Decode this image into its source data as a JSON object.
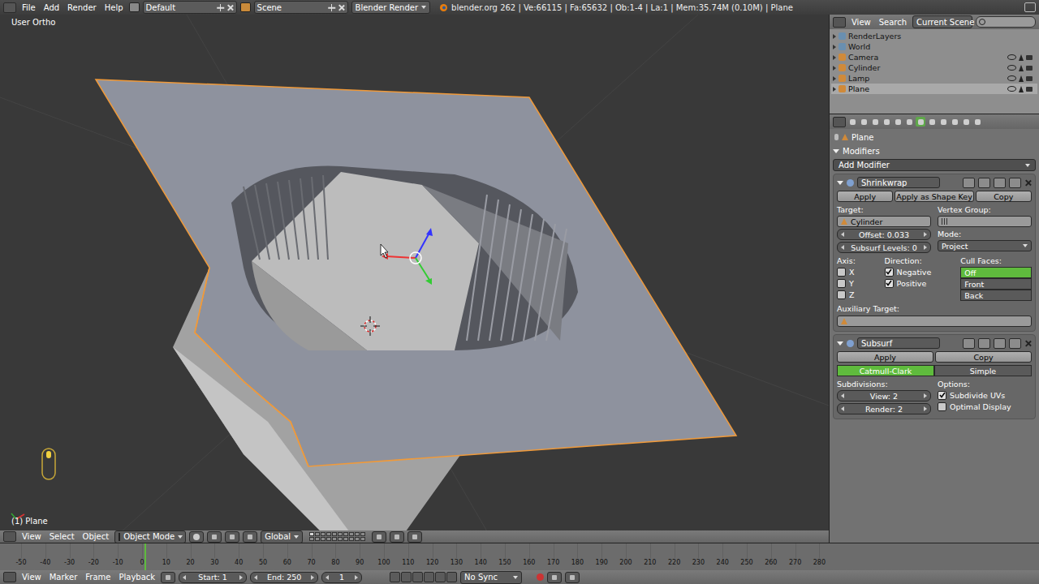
{
  "top_bar": {
    "menus": [
      "File",
      "Add",
      "Render",
      "Help"
    ],
    "layout": "Default",
    "scene": "Scene",
    "engine": "Blender Render",
    "stats": "blender.org 262 | Ve:66115 | Fa:65632 | Ob:1-4 | La:1 | Mem:35.74M (0.10M) | Plane"
  },
  "viewport": {
    "view_label": "User Ortho",
    "object_label": "(1) Plane"
  },
  "viewport_header": {
    "menus": [
      "View",
      "Select",
      "Object"
    ],
    "mode": "Object Mode",
    "orientation": "Global",
    "layers": [
      {
        "active": true
      },
      {
        "active": false
      },
      {
        "active": false
      },
      {
        "active": false
      },
      {
        "active": false
      },
      {
        "active": false
      },
      {
        "active": false
      },
      {
        "active": false
      },
      {
        "active": false
      },
      {
        "active": false
      },
      {
        "active": false
      },
      {
        "active": false
      },
      {
        "active": false
      },
      {
        "active": false
      },
      {
        "active": false
      },
      {
        "active": false
      },
      {
        "active": false
      },
      {
        "active": false
      },
      {
        "active": false
      },
      {
        "active": false
      }
    ]
  },
  "outliner": {
    "menus": [
      "View",
      "Search"
    ],
    "filter": "Current Scene",
    "search": "",
    "items": [
      {
        "label": "RenderLayers",
        "kind": "scene",
        "selected": false
      },
      {
        "label": "World",
        "kind": "scene",
        "selected": false
      },
      {
        "label": "Camera",
        "kind": "object",
        "selected": false
      },
      {
        "label": "Cylinder",
        "kind": "object",
        "selected": false
      },
      {
        "label": "Lamp",
        "kind": "object",
        "selected": false
      },
      {
        "label": "Plane",
        "kind": "object",
        "selected": true
      }
    ]
  },
  "properties": {
    "tabs": [
      {
        "selected": false
      },
      {
        "selected": false
      },
      {
        "selected": false
      },
      {
        "selected": false
      },
      {
        "selected": false
      },
      {
        "selected": false
      },
      {
        "selected": true
      },
      {
        "selected": false
      },
      {
        "selected": false
      },
      {
        "selected": false
      },
      {
        "selected": false
      },
      {
        "selected": false
      }
    ],
    "context": "Plane",
    "section": "Modifiers",
    "add_button": "Add Modifier"
  },
  "shrinkwrap": {
    "name": "Shrinkwrap",
    "expanded": true,
    "buttons": [
      "Apply",
      "Apply as Shape Key",
      "Copy"
    ],
    "target_label": "Target:",
    "target": "Cylinder",
    "vertex_group_label": "Vertex Group:",
    "vertex_group": "",
    "offset": "Offset: 0.033",
    "mode_label": "Mode:",
    "subsurf_levels": "Subsurf Levels: 0",
    "mode": "Project",
    "axis_label": "Axis:",
    "axes": [
      {
        "label": "X",
        "checked": false
      },
      {
        "label": "Y",
        "checked": false
      },
      {
        "label": "Z",
        "checked": false
      }
    ],
    "direction_label": "Direction:",
    "directions": [
      {
        "label": "Negative",
        "checked": true
      },
      {
        "label": "Positive",
        "checked": true
      }
    ],
    "cull_label": "Cull Faces:",
    "cull_options": [
      {
        "label": "Off",
        "selected": true
      },
      {
        "label": "Front",
        "selected": false
      },
      {
        "label": "Back",
        "selected": false
      }
    ],
    "aux_label": "Auxiliary Target:",
    "aux_target": ""
  },
  "subsurf": {
    "name": "Subsurf",
    "expanded": true,
    "buttons": [
      "Apply",
      "Copy"
    ],
    "types": [
      {
        "label": "Catmull-Clark",
        "selected": true
      },
      {
        "label": "Simple",
        "selected": false
      }
    ],
    "subdivisions_label": "Subdivisions:",
    "view": "View: 2",
    "render": "Render: 2",
    "options_label": "Options:",
    "options": [
      {
        "label": "Subdivide UVs",
        "checked": true
      },
      {
        "label": "Optimal Display",
        "checked": false
      }
    ]
  },
  "timeline": {
    "ticks": [
      "-50",
      "-40",
      "-30",
      "-20",
      "-10",
      "0",
      "10",
      "20",
      "30",
      "40",
      "50",
      "60",
      "70",
      "80",
      "90",
      "100",
      "110",
      "120",
      "130",
      "140",
      "150",
      "160",
      "170",
      "180",
      "190",
      "200",
      "210",
      "220",
      "230",
      "240",
      "250",
      "260",
      "270",
      "280"
    ],
    "current_frame": "1",
    "menus": [
      "View",
      "Marker",
      "Frame",
      "Playback"
    ],
    "start": "Start: 1",
    "end": "End: 250",
    "frame": "1",
    "sync": "No Sync"
  }
}
